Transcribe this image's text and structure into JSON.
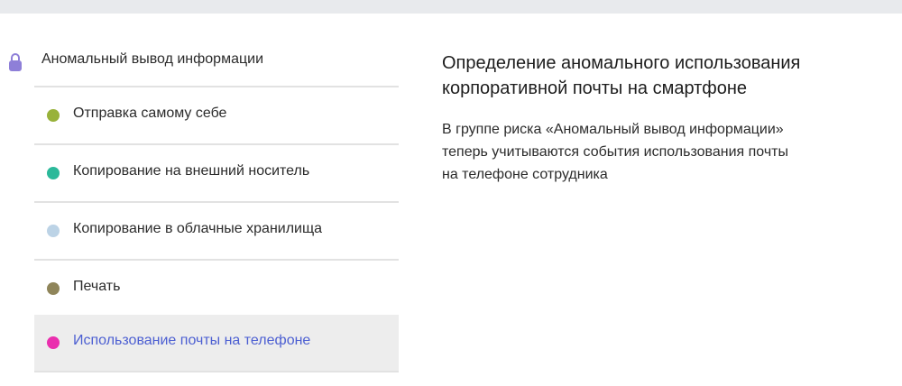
{
  "group": {
    "label": "Аномальный вывод информации",
    "icon": "lock-icon",
    "icon_color": "#8e7fd8"
  },
  "items": [
    {
      "label": "Отправка самому себе",
      "color": "#98b23a",
      "selected": false
    },
    {
      "label": "Копирование на внешний носитель",
      "color": "#2bb99a",
      "selected": false
    },
    {
      "label": "Копирование в облачные хранилища",
      "color": "#bcd3e6",
      "selected": false
    },
    {
      "label": "Печать",
      "color": "#8f855a",
      "selected": false
    },
    {
      "label": "Использование почты на телефоне",
      "color": "#ea2fae",
      "selected": true
    }
  ],
  "detail": {
    "heading_line1": "Определение аномального использования",
    "heading_line2": "корпоративной почты на смартфоне",
    "desc_line1": "В группе риска «Аномальный вывод информации»",
    "desc_line2": "теперь учитываются события использования почты",
    "desc_line3": "на телефоне сотрудника"
  }
}
